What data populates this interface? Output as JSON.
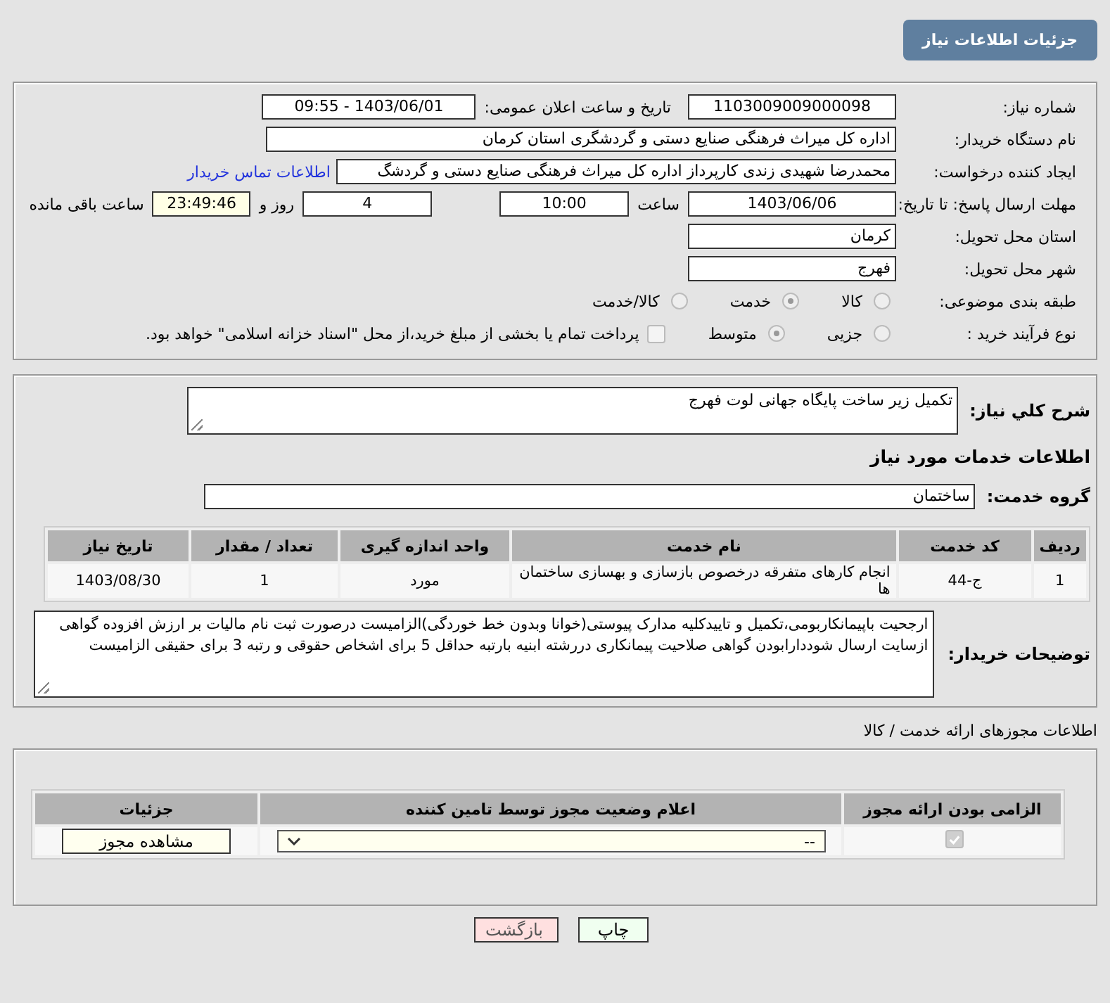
{
  "header": {
    "title": "جزئیات اطلاعات نیاز"
  },
  "need_info": {
    "need_number": {
      "label": "شماره نیاز:",
      "value": "1103009009000098"
    },
    "announce_datetime": {
      "label": "تاریخ و ساعت اعلان عمومی:",
      "value": "1403/06/01 - 09:55"
    },
    "buyer_org": {
      "label": "نام دستگاه خریدار:",
      "value": "اداره کل میراث فرهنگی  صنایع دستی و گردشگری استان کرمان"
    },
    "requester": {
      "label": "ایجاد کننده درخواست:",
      "value": "محمدرضا شهیدی زندی کارپرداز اداره کل میراث فرهنگی  صنایع دستی و گردشگ",
      "link": "اطلاعات تماس خریدار"
    },
    "deadline": {
      "label": "مهلت ارسال پاسخ: تا تاریخ:",
      "date": "1403/06/06",
      "time_label": "ساعت",
      "time": "10:00",
      "days": "4",
      "days_label": "روز و",
      "remaining": "23:49:46",
      "remaining_label": "ساعت باقی مانده"
    },
    "province": {
      "label": "استان محل تحویل:",
      "value": "کرمان"
    },
    "city": {
      "label": "شهر محل تحویل:",
      "value": "فهرج"
    },
    "category": {
      "label": "طبقه بندی موضوعی:",
      "options": [
        {
          "label": "کالا",
          "selected": false
        },
        {
          "label": "خدمت",
          "selected": true
        },
        {
          "label": "کالا/خدمت",
          "selected": false
        }
      ]
    },
    "purchase_process": {
      "label": "نوع فرآیند خرید :",
      "options": [
        {
          "label": "جزیی",
          "selected": false
        },
        {
          "label": "متوسط",
          "selected": true
        }
      ],
      "payment": {
        "label": "پرداخت تمام یا بخشی از مبلغ خرید،از محل \"اسناد خزانه اسلامی\" خواهد بود.",
        "checked": false
      }
    }
  },
  "description": {
    "label": "شرح کلي نیاز:",
    "value": "تکمیل زیر ساخت پایگاه جهانی لوت فهرج"
  },
  "services": {
    "title": "اطلاعات خدمات مورد نیاز",
    "group_label": "گروه خدمت:",
    "group": "ساختمان",
    "columns": [
      "ردیف",
      "کد خدمت",
      "نام خدمت",
      "واحد اندازه گیری",
      "تعداد / مقدار",
      "تاریخ نیاز"
    ],
    "rows": [
      [
        "1",
        "ج-44",
        "انجام کارهای متفرقه درخصوص بازسازی و بهسازی ساختمان ها",
        "مورد",
        "1",
        "1403/08/30"
      ]
    ]
  },
  "buyer_notes": {
    "label": "توضیحات خریدار:",
    "value": "ارجحیت باپیمانکاربومی،تکمیل و تاییدکلیه مدارک پیوستی(خوانا وبدون خط خوردگی)الزامیست درصورت ثبت نام مالیات بر ارزش افزوده گواهی ازسایت ارسال شوددارابودن گواهی صلاحیت پیمانکاری دررشته ابنیه بارتبه حداقل 5 برای اشخاص حقوقی و رتبه 3 برای حقیقی الزامیست"
  },
  "permits": {
    "title": "اطلاعات مجوزهای ارائه خدمت / کالا",
    "columns": [
      "الزامی بودن ارائه مجوز",
      "اعلام وضعیت مجوز توسط تامین کننده",
      "جزئیات"
    ],
    "rows": [
      {
        "required": true,
        "status": "--",
        "details_button": "مشاهده مجوز"
      }
    ]
  },
  "buttons": [
    {
      "label": "چاپ",
      "kind": "print"
    },
    {
      "label": "بازگشت",
      "kind": "back"
    }
  ]
}
